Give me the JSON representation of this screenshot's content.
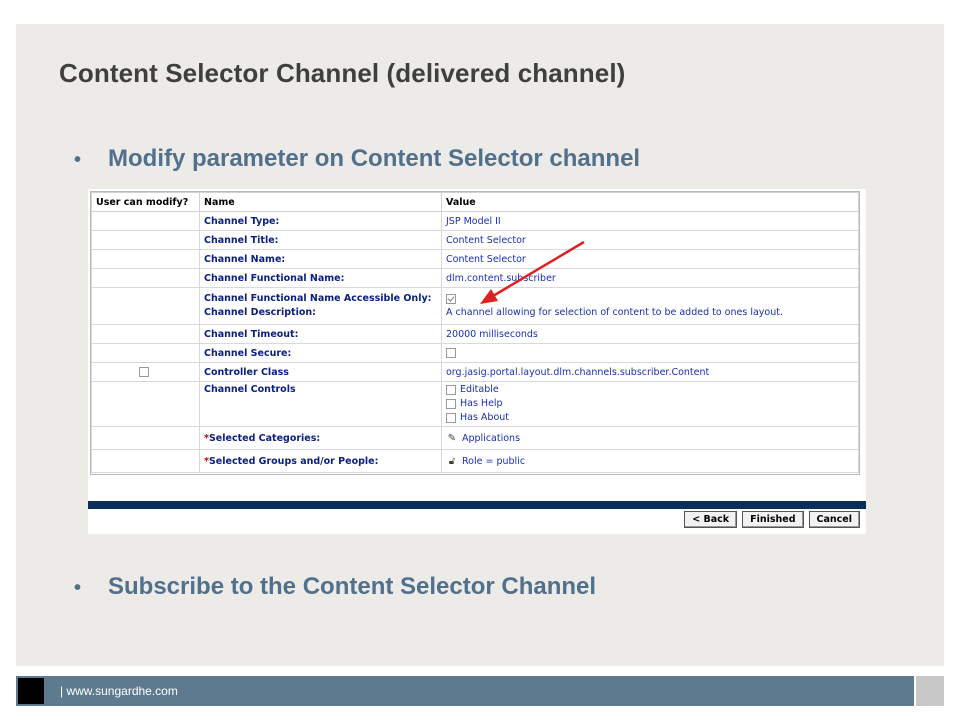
{
  "slide": {
    "title": "Content Selector Channel (delivered channel)",
    "bullets": [
      "Modify parameter on Content Selector channel",
      "Subscribe to the Content Selector Channel"
    ],
    "bullet_char": "•"
  },
  "screenshot": {
    "headers": {
      "modify": "User can modify?",
      "name": "Name",
      "value": "Value"
    },
    "rows": [
      {
        "name": "Channel Type:",
        "value": "JSP Model II"
      },
      {
        "name": "Channel Title:",
        "value": "Content Selector"
      },
      {
        "name": "Channel Name:",
        "value": "Content Selector"
      },
      {
        "name": "Channel Functional Name:",
        "value": "dlm.content.subscriber"
      },
      {
        "name": "Channel Functional Name Accessible Only:",
        "name2": "Channel Description:",
        "value_checked": true,
        "value2": "A channel allowing for selection of content to be added to ones layout."
      },
      {
        "name": "Channel Timeout:",
        "value": "20000 milliseconds"
      },
      {
        "name": "Channel Secure:",
        "value_checked": false
      },
      {
        "name": "Controller Class",
        "value": "org.jasig.portal.layout.dlm.channels.subscriber.Content",
        "modify_checked": false
      },
      {
        "name": "Channel Controls",
        "controls": [
          "Editable",
          "Has Help",
          "Has About"
        ]
      },
      {
        "required": "*",
        "name": "Selected Categories:",
        "value": "Applications",
        "icon": "folder-icon"
      },
      {
        "required": "*",
        "name": "Selected Groups and/or People:",
        "value": "Role = public",
        "icon": "lock-icon"
      }
    ],
    "buttons": {
      "back": "< Back",
      "finished": "Finished",
      "cancel": "Cancel"
    }
  },
  "footer": {
    "text": "| www.sungardhe.com"
  },
  "colors": {
    "slide_bg": "#edebe8",
    "bullet_text": "#51708c",
    "footer_bar": "#5e7a8e",
    "arrow": "#e02020"
  }
}
